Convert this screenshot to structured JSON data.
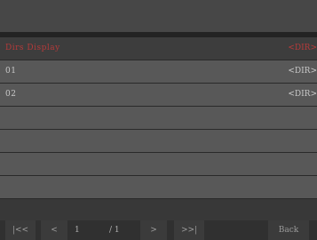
{
  "file_list": {
    "rows": [
      {
        "name": "Dirs Display",
        "kind": "<DIR>",
        "selected": true
      },
      {
        "name": "01",
        "kind": "<DIR>",
        "selected": false
      },
      {
        "name": "02",
        "kind": "<DIR>",
        "selected": false
      },
      {
        "name": "",
        "kind": "",
        "selected": false
      },
      {
        "name": "",
        "kind": "",
        "selected": false
      },
      {
        "name": "",
        "kind": "",
        "selected": false
      },
      {
        "name": "",
        "kind": "",
        "selected": false
      }
    ]
  },
  "pager": {
    "first_label": "|<<",
    "prev_label": "<",
    "current_page": "1",
    "total_pages": "/ 1",
    "next_label": ">",
    "last_label": ">>|",
    "back_label": "Back"
  }
}
